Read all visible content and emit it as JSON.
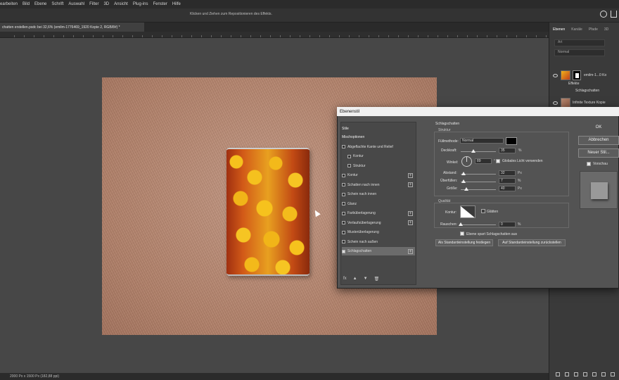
{
  "menu": [
    "earbeiten",
    "Bild",
    "Ebene",
    "Schrift",
    "Auswahl",
    "Filter",
    "3D",
    "Ansicht",
    "Plug-ins",
    "Fenster",
    "Hilfe"
  ],
  "options_bar": {
    "hint": "Klicken und Ziehen zum Repositionieren des Effekts."
  },
  "document_tab": {
    "label": "chatten erstellen.psdc bei 32,6% (emilm-1776469_1920 Kopie 2, RGB/8#) *"
  },
  "status_bar": {
    "text": "2000 Px x 1500 Px (182,88 ppi)"
  },
  "layers_panel": {
    "tabs": [
      "Ebenen",
      "Kanäle",
      "Pfade",
      "3D"
    ],
    "active_tab": "Ebenen",
    "search_placeholder": "Art",
    "filter_label": "Normal",
    "layers": [
      {
        "name": "emilm-1...0 Ko"
      },
      {
        "name": "Effekte"
      },
      {
        "name": "Schlagschatten"
      },
      {
        "name": "Infinite Texture Kopie"
      }
    ]
  },
  "dialog": {
    "title": "Ebenenstil",
    "styles": [
      {
        "label": "Stile",
        "type": "header"
      },
      {
        "label": "Mischoptionen",
        "type": "header"
      },
      {
        "label": "Abgeflachte Kante und Relief",
        "checked": false,
        "plus": false
      },
      {
        "label": "Kontur",
        "checked": false,
        "plus": false,
        "sub": true
      },
      {
        "label": "Struktur",
        "checked": false,
        "plus": false,
        "sub": true
      },
      {
        "label": "Kontur",
        "checked": false,
        "plus": true
      },
      {
        "label": "Schatten nach innen",
        "checked": false,
        "plus": true
      },
      {
        "label": "Schein nach innen",
        "checked": false,
        "plus": false
      },
      {
        "label": "Glanz",
        "checked": false,
        "plus": false
      },
      {
        "label": "Farbüberlagerung",
        "checked": false,
        "plus": true
      },
      {
        "label": "Verlaufsüberlagerung",
        "checked": false,
        "plus": true
      },
      {
        "label": "Musterüberlagerung",
        "checked": false,
        "plus": false
      },
      {
        "label": "Schein nach außen",
        "checked": false,
        "plus": false
      },
      {
        "label": "Schlagschatten",
        "checked": true,
        "plus": true,
        "selected": true
      }
    ],
    "list_tools": [
      "fx",
      "▲",
      "▼",
      "🗑"
    ],
    "section_title": "Schlagschatten",
    "structure_title": "Struktur",
    "fill_method_label": "Füllmethode:",
    "fill_method_value": "Normal",
    "opacity_label": "Deckkraft:",
    "opacity_value": "35",
    "opacity_unit": "%",
    "angle_label": "Winkel:",
    "angle_value": "89",
    "angle_unit": "°",
    "global_light_label": "Globales Licht verwenden",
    "distance_label": "Abstand:",
    "distance_value": "32",
    "distance_unit": "Px",
    "spread_label": "Überfüllen:",
    "spread_value": "7",
    "spread_unit": "%",
    "size_label": "Größe:",
    "size_value": "40",
    "size_unit": "Px",
    "quality_title": "Qualität",
    "contour_label": "Kontur:",
    "smooth_label": "Glätten",
    "noise_label": "Rauschen:",
    "noise_value": "0",
    "noise_unit": "%",
    "knockout_label": "Ebene spart Schlagschatten aus",
    "default_set_label": "Als Standardeinstellung festlegen",
    "default_reset_label": "Auf Standardeinstellung zurückstellen",
    "buttons": {
      "ok": "OK",
      "cancel": "Abbrechen",
      "new_style": "Neuer Stil...",
      "preview": "Vorschau"
    },
    "shadow_color": "#000000",
    "sliders": {
      "opacity": 0.35,
      "distance": 0.08,
      "spread": 0.07,
      "size": 0.16,
      "noise": 0.0
    }
  }
}
